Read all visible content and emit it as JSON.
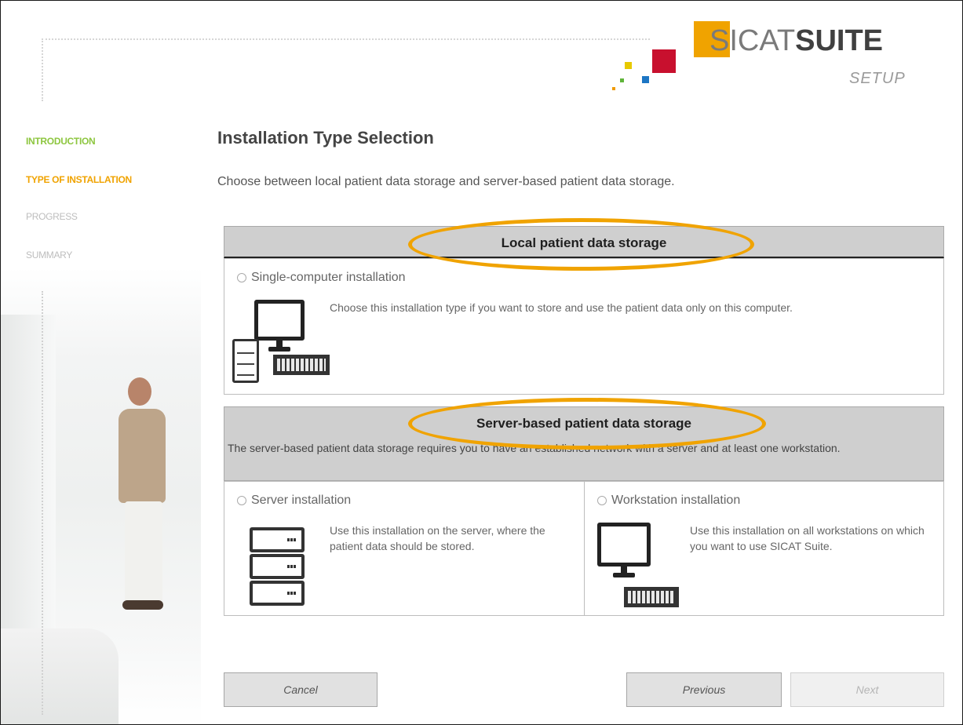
{
  "logo": {
    "brand_light": "SICAT",
    "brand_bold": "SUITE",
    "subtitle": "SETUP"
  },
  "sidebar": {
    "items": [
      {
        "label": "INTRODUCTION",
        "state": "done",
        "color": "#8dc63f"
      },
      {
        "label": "TYPE OF INSTALLATION",
        "state": "current",
        "color": "#f0a300"
      },
      {
        "label": "PROGRESS",
        "state": "pending",
        "color": "#bdbdbd"
      },
      {
        "label": "SUMMARY",
        "state": "pending",
        "color": "#bdbdbd"
      }
    ]
  },
  "main": {
    "title": "Installation Type Selection",
    "description": "Choose between local patient data storage and server-based patient data storage.",
    "local": {
      "header": "Local patient data storage",
      "option": {
        "label": "Single-computer installation",
        "text": "Choose this installation type if you want to store and use the patient data only on this computer.",
        "selected": false
      }
    },
    "server": {
      "header": "Server-based patient data storage",
      "description": "The server-based patient data storage requires you to have an established network with a server and at least one workstation.",
      "server_option": {
        "label": "Server installation",
        "text": "Use this installation on the server, where the patient data should be stored.",
        "selected": false
      },
      "workstation_option": {
        "label": "Workstation installation",
        "text": "Use this installation on all workstations on which you want to use SICAT Suite.",
        "selected": false
      }
    }
  },
  "buttons": {
    "cancel": "Cancel",
    "previous": "Previous",
    "next": "Next"
  },
  "colors": {
    "highlight": "#f0a300",
    "header_bg": "#cfcfcf"
  }
}
